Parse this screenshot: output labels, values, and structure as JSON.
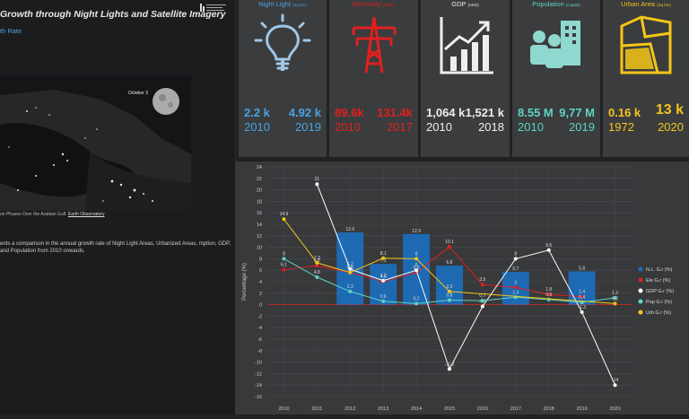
{
  "page": {
    "title": "Growth through Night Lights and Satellite Imagery",
    "subtitle": "th Rate",
    "image_date_label": "October 3",
    "image_caption": "on Phases Over the Arabian Gulf.",
    "image_caption_link": "Earth Observatory",
    "description": "ents a comparison in the annual growth rate of Night Light Areas, Urbanized Areas, mption, GDP, and Population from 2010 onwards."
  },
  "cards": [
    {
      "title": "Night Light",
      "unit": "(Sq km)",
      "icon": "lightbulb-icon",
      "color": "#4aa3df",
      "icon_color": "#9fc6e6",
      "start_value": "2.2 k",
      "start_year": "2010",
      "end_value": "4.92 k",
      "end_year": "2019"
    },
    {
      "title": "Electricity",
      "unit": "(GWh)",
      "icon": "power-pylon-icon",
      "color": "#e0201f",
      "icon_color": "#e0201f",
      "start_value": "89.6k",
      "start_year": "2010",
      "end_value": "131.4k",
      "end_year": "2017"
    },
    {
      "title": "GDP",
      "unit": "(AED)",
      "icon": "growth-chart-icon",
      "color": "#eeeeee",
      "icon_color": "#eeeeee",
      "start_value": "1,064 k",
      "start_year": "2010",
      "end_value": "1,521 k",
      "end_year": "2018"
    },
    {
      "title": "Population",
      "unit": "(Capita)",
      "icon": "population-icon",
      "color": "#5fd3c4",
      "icon_color": "#8fd8cf",
      "start_value": "8.55 M",
      "start_year": "2010",
      "end_value": "9,77 M",
      "end_year": "2019"
    },
    {
      "title": "Urban Area",
      "unit": "(Sq km)",
      "icon": "urban-map-icon",
      "color": "#f5c518",
      "icon_color": "#f5c518",
      "start_value": "0.16 k",
      "start_year": "1972",
      "end_value": "13 k",
      "end_year": "2020"
    }
  ],
  "chart_data": {
    "type": "bar",
    "x": [
      "2010",
      "2011",
      "2012",
      "2013",
      "2014",
      "2015",
      "2016",
      "2017",
      "2018",
      "2019",
      "2020"
    ],
    "ylim": [
      -16,
      24
    ],
    "yticks": [
      -16,
      -14,
      -12,
      -10,
      -8,
      -6,
      -4,
      -2,
      0,
      2,
      4,
      6,
      8,
      10,
      12,
      14,
      16,
      18,
      20,
      22,
      24
    ],
    "ylabel": "Percentage (%)",
    "grid": true,
    "legend_position": "right",
    "bars": {
      "name": "N.L. G.r (%)",
      "color": "#1b6fc0",
      "values": [
        null,
        null,
        12.6,
        7.1,
        12.3,
        6.8,
        null,
        5.7,
        null,
        5.8,
        null
      ]
    },
    "series": [
      {
        "name": "Ele G.r (%)",
        "color": "#e0201f",
        "values": [
          6.1,
          6.8,
          5.6,
          4.0,
          5.6,
          10.1,
          3.5,
          3.0,
          1.8,
          1.4,
          null
        ],
        "labels": [
          "6.1",
          "6.8",
          "5.6",
          "4.0",
          "5.6",
          "10.1",
          "3.5",
          "3",
          "1.8",
          "1.4",
          ""
        ]
      },
      {
        "name": "GDP G.r (%)",
        "color": "#ffffff",
        "values": [
          null,
          21,
          6.2,
          4.2,
          6.0,
          -11.2,
          -0.3,
          8,
          9.5,
          -1.3,
          -14
        ],
        "labels": [
          "",
          "21",
          "6.2",
          "4.2",
          "6",
          "-11.2",
          "-0.3",
          "8",
          "9.5",
          "-1.3",
          "-14"
        ]
      },
      {
        "name": "Pop G.r (%)",
        "color": "#5fd3c4",
        "values": [
          8,
          4.8,
          2.3,
          0.6,
          0.2,
          0.8,
          0.7,
          1.3,
          0.9,
          0.4,
          1.2
        ],
        "labels": [
          "8",
          "4.8",
          "2.3",
          "0.6",
          "0.2",
          "0.8",
          "0.7",
          "1.3",
          "0.9",
          "0.4",
          "1.2"
        ]
      },
      {
        "name": "Urb G.r (%)",
        "color": "#f5c518",
        "values": [
          14.9,
          7.3,
          5.6,
          8.1,
          8.0,
          2.3,
          null,
          null,
          null,
          null,
          0.2
        ],
        "labels": [
          "14.9",
          "7.3",
          "5.6",
          "8.1",
          "8",
          "2.3",
          "",
          "",
          "",
          "",
          "0.2"
        ]
      }
    ]
  }
}
